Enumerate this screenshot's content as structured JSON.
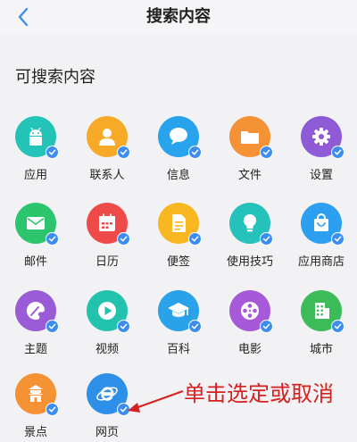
{
  "header": {
    "title": "搜索内容",
    "back_icon": "chevron-left-icon"
  },
  "section": {
    "title": "可搜索内容"
  },
  "items": [
    {
      "label": "应用",
      "icon": "android-icon",
      "color": "#23c3b7",
      "checked": true
    },
    {
      "label": "联系人",
      "icon": "contact-icon",
      "color": "#f7a928",
      "checked": true
    },
    {
      "label": "信息",
      "icon": "message-icon",
      "color": "#29a4ec",
      "checked": true
    },
    {
      "label": "文件",
      "icon": "folder-icon",
      "color": "#f59235",
      "checked": true
    },
    {
      "label": "设置",
      "icon": "gear-icon",
      "color": "#8e5ad6",
      "checked": true
    },
    {
      "label": "邮件",
      "icon": "mail-icon",
      "color": "#2cc56d",
      "checked": true
    },
    {
      "label": "日历",
      "icon": "calendar-icon",
      "color": "#ef4a4a",
      "checked": true
    },
    {
      "label": "便签",
      "icon": "note-icon",
      "color": "#f8b621",
      "checked": true
    },
    {
      "label": "使用技巧",
      "icon": "lightbulb-icon",
      "color": "#25c1bb",
      "checked": true
    },
    {
      "label": "应用商店",
      "icon": "shopping-bag-icon",
      "color": "#2d9ff0",
      "checked": true
    },
    {
      "label": "主题",
      "icon": "palette-icon",
      "color": "#9a5bd6",
      "checked": true
    },
    {
      "label": "视频",
      "icon": "play-icon",
      "color": "#23c2ae",
      "checked": true
    },
    {
      "label": "百科",
      "icon": "graduation-cap-icon",
      "color": "#2aa2ea",
      "checked": true
    },
    {
      "label": "电影",
      "icon": "film-reel-icon",
      "color": "#a659d8",
      "checked": true
    },
    {
      "label": "城市",
      "icon": "building-icon",
      "color": "#3cbc58",
      "checked": true
    },
    {
      "label": "景点",
      "icon": "landmark-icon",
      "color": "#f59233",
      "checked": true
    },
    {
      "label": "网页",
      "icon": "browser-e-icon",
      "color": "#2d8fe8",
      "checked": true
    }
  ],
  "annotation": {
    "text": "单击选定或取消",
    "color": "#d62020"
  }
}
